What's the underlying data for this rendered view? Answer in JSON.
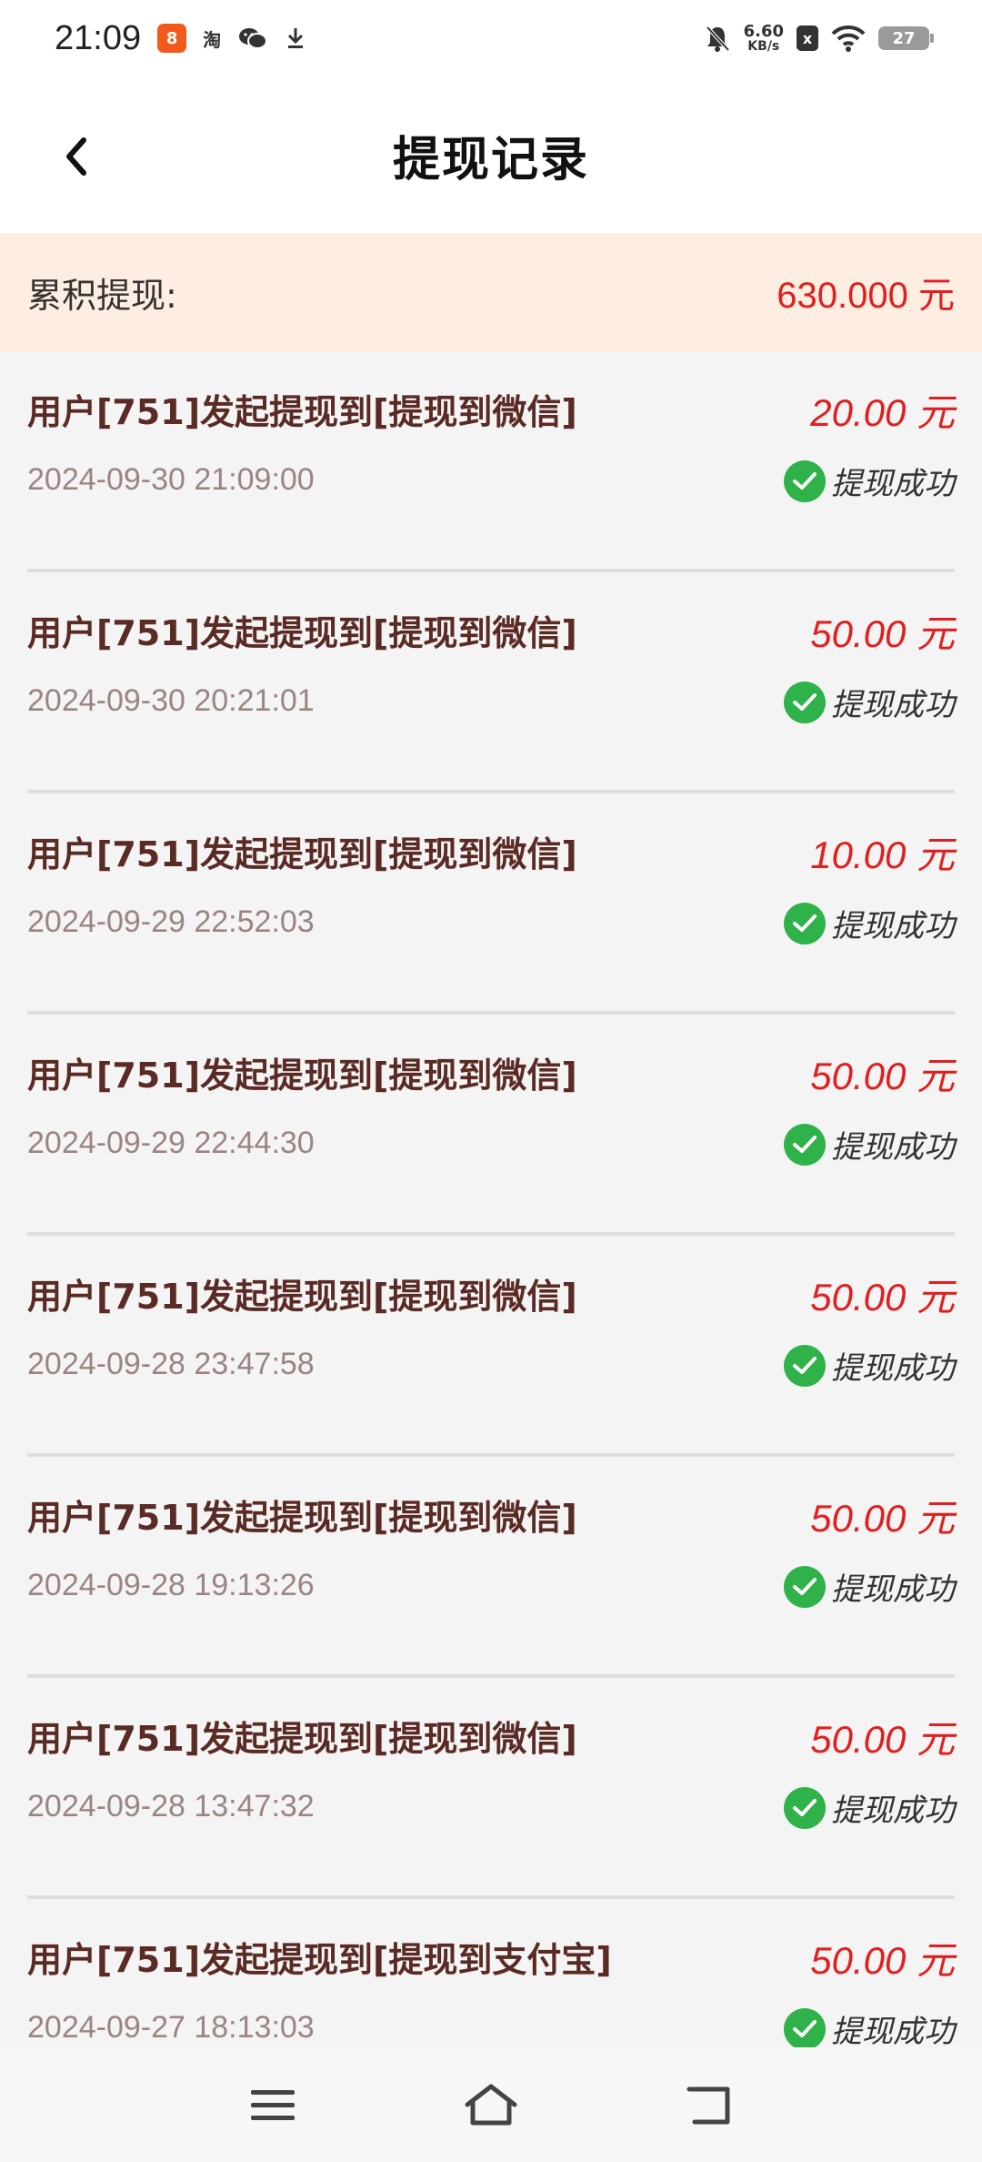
{
  "status_bar": {
    "time": "21:09",
    "app_badge": "8",
    "tao_label": "淘",
    "net_speed_value": "6.60",
    "net_speed_unit": "KB/s",
    "sim_label": "x",
    "battery_level": "27",
    "icons": [
      "app-badge-icon",
      "taobao-icon",
      "wechat-icon",
      "download-icon",
      "mute-bell-icon",
      "no-sim-icon",
      "wifi-icon",
      "battery-icon"
    ]
  },
  "header": {
    "title": "提现记录",
    "back_icon": "chevron-left-icon"
  },
  "summary": {
    "label": "累积提现:",
    "value": "630.000 元"
  },
  "records": [
    {
      "title": "用户[751]发起提现到[提现到微信]",
      "amount": "20.00 元",
      "date": "2024-09-30 21:09:00",
      "status": "提现成功"
    },
    {
      "title": "用户[751]发起提现到[提现到微信]",
      "amount": "50.00 元",
      "date": "2024-09-30 20:21:01",
      "status": "提现成功"
    },
    {
      "title": "用户[751]发起提现到[提现到微信]",
      "amount": "10.00 元",
      "date": "2024-09-29 22:52:03",
      "status": "提现成功"
    },
    {
      "title": "用户[751]发起提现到[提现到微信]",
      "amount": "50.00 元",
      "date": "2024-09-29 22:44:30",
      "status": "提现成功"
    },
    {
      "title": "用户[751]发起提现到[提现到微信]",
      "amount": "50.00 元",
      "date": "2024-09-28 23:47:58",
      "status": "提现成功"
    },
    {
      "title": "用户[751]发起提现到[提现到微信]",
      "amount": "50.00 元",
      "date": "2024-09-28 19:13:26",
      "status": "提现成功"
    },
    {
      "title": "用户[751]发起提现到[提现到微信]",
      "amount": "50.00 元",
      "date": "2024-09-28 13:47:32",
      "status": "提现成功"
    },
    {
      "title": "用户[751]发起提现到[提现到支付宝]",
      "amount": "50.00 元",
      "date": "2024-09-27 18:13:03",
      "status": "提现成功"
    }
  ],
  "colors": {
    "accent_red": "#e02020",
    "title_brown": "#5a2a24",
    "date_gray": "#9b8580",
    "success_green": "#2fb24a",
    "summary_bg": "#fdeee1"
  },
  "nav_bar": {
    "icons": [
      "menu-icon",
      "home-icon",
      "back-icon"
    ]
  }
}
